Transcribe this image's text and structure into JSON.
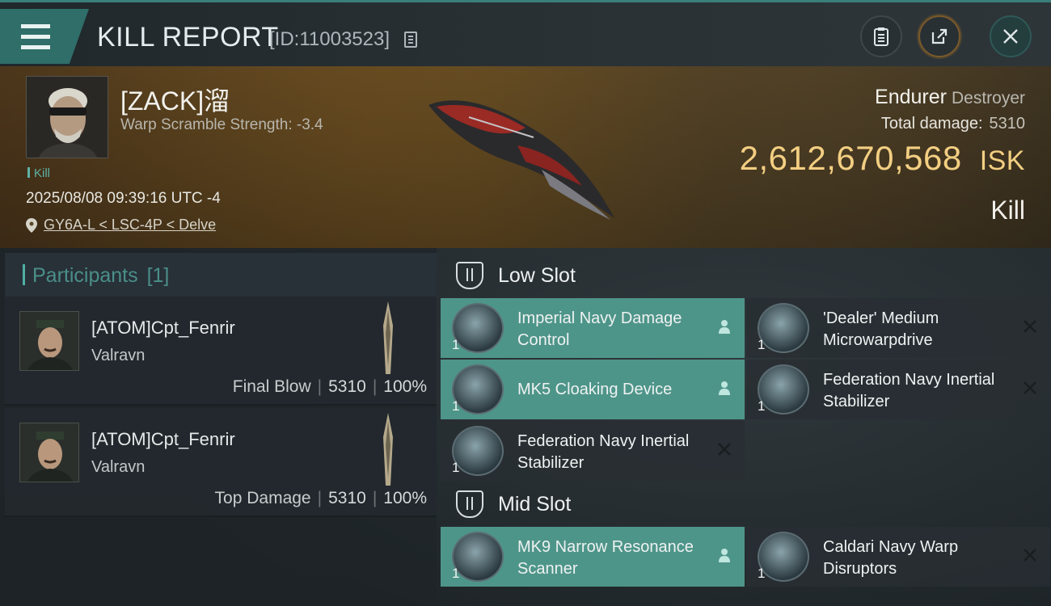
{
  "header": {
    "title": "KILL REPORT",
    "id_text": "[ID:11003523]"
  },
  "victim": {
    "name": "[ZACK]溜",
    "warp_scramble": "Warp Scramble Strength: -3.4",
    "tag": "Kill",
    "datetime": "2025/08/08 09:39:16 UTC -4",
    "location": "GY6A-L < LSC-4P < Delve",
    "ship": "Endurer",
    "ship_class": "Destroyer",
    "total_damage_label": "Total damage:",
    "total_damage": "5310",
    "isk_value": "2,612,670,568",
    "isk_unit": "ISK",
    "result": "Kill"
  },
  "participants": {
    "label": "Participants",
    "count": "[1]",
    "rows": [
      {
        "name": "[ATOM]Cpt_Fenrir",
        "ship": "Valravn",
        "role": "Final Blow",
        "damage": "5310",
        "percent": "100%"
      },
      {
        "name": "[ATOM]Cpt_Fenrir",
        "ship": "Valravn",
        "role": "Top Damage",
        "damage": "5310",
        "percent": "100%"
      }
    ]
  },
  "slots": {
    "low": {
      "title": "Low Slot",
      "modules": [
        {
          "name": "Imperial Navy Damage Control",
          "qty": "1",
          "status": "dropped",
          "icon": "damage-control-icon"
        },
        {
          "name": "'Dealer' Medium Microwarpdrive",
          "qty": "1",
          "status": "destroyed",
          "icon": "microwarpdrive-icon"
        },
        {
          "name": "MK5 Cloaking Device",
          "qty": "1",
          "status": "dropped",
          "icon": "cloaking-device-icon"
        },
        {
          "name": "Federation Navy Inertial Stabilizer",
          "qty": "1",
          "status": "destroyed",
          "icon": "inertial-stabilizer-icon"
        },
        {
          "name": "Federation Navy Inertial Stabilizer",
          "qty": "1",
          "status": "destroyed",
          "icon": "inertial-stabilizer-icon"
        }
      ]
    },
    "mid": {
      "title": "Mid Slot",
      "modules": [
        {
          "name": "MK9 Narrow Resonance Scanner",
          "qty": "1",
          "status": "dropped",
          "icon": "scanner-icon"
        },
        {
          "name": "Caldari Navy Warp Disruptors",
          "qty": "1",
          "status": "destroyed",
          "icon": "warp-disruptor-icon"
        }
      ]
    }
  },
  "colors": {
    "accent": "#4e9589",
    "isk": "#f3cf82",
    "header_teal": "#2f6e69"
  }
}
